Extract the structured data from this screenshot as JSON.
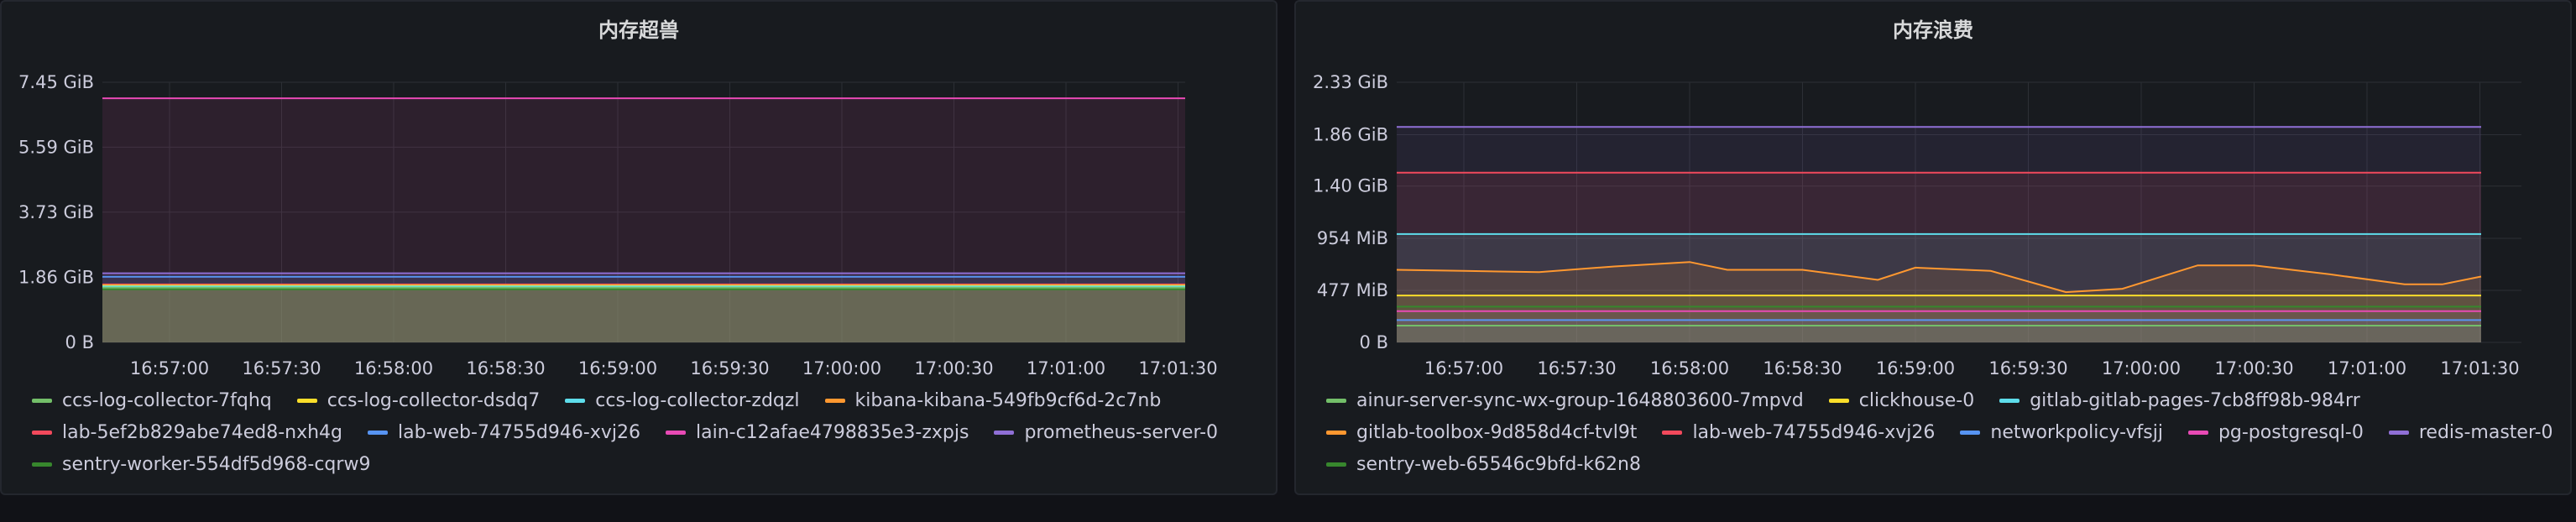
{
  "colors": {
    "background": "#111217",
    "panel": "#181b1f",
    "grid": "#2c2f35",
    "green": "#73bf69",
    "yellow": "#fade2a",
    "cyan": "#5eddeb",
    "orange": "#ff9830",
    "red": "#f2495c",
    "blue": "#5794f2",
    "pink": "#e84ab5",
    "purple": "#8f6fd6",
    "darkgreen": "#37872d"
  },
  "chart_data": [
    {
      "type": "area",
      "title": "内存超兽",
      "unit": "GiB",
      "x": [
        "16:56:30",
        "16:57:00",
        "16:57:30",
        "16:58:00",
        "16:58:30",
        "16:59:00",
        "16:59:30",
        "17:00:00",
        "17:00:30",
        "17:01:00",
        "17:01:20"
      ],
      "x_tick_labels": [
        "16:57:00",
        "16:57:30",
        "16:58:00",
        "16:58:30",
        "16:59:00",
        "16:59:30",
        "17:00:00",
        "17:00:30",
        "17:01:00",
        "17:01:30"
      ],
      "ylim": [
        0,
        7.45
      ],
      "y_ticks": [
        0,
        1.86,
        3.73,
        5.59,
        7.45
      ],
      "y_tick_labels": [
        "0 B",
        "1.86 GiB",
        "3.73 GiB",
        "5.59 GiB",
        "7.45 GiB"
      ],
      "grid": true,
      "legend_position": "bottom",
      "series": [
        {
          "name": "ccs-log-collector-7fqhq",
          "color": "#73bf69",
          "values": [
            1.57,
            1.57,
            1.57,
            1.57,
            1.57,
            1.57,
            1.57,
            1.57,
            1.57,
            1.57,
            1.57
          ]
        },
        {
          "name": "ccs-log-collector-dsdq7",
          "color": "#fade2a",
          "values": [
            1.62,
            1.62,
            1.62,
            1.62,
            1.62,
            1.62,
            1.62,
            1.62,
            1.62,
            1.62,
            1.62
          ]
        },
        {
          "name": "ccs-log-collector-zdqzl",
          "color": "#5eddeb",
          "values": [
            1.6,
            1.6,
            1.6,
            1.6,
            1.6,
            1.6,
            1.6,
            1.6,
            1.6,
            1.6,
            1.6
          ]
        },
        {
          "name": "kibana-kibana-549fb9cf6d-2c7nb",
          "color": "#ff9830",
          "values": [
            1.64,
            1.64,
            1.64,
            1.64,
            1.64,
            1.64,
            1.64,
            1.64,
            1.64,
            1.64,
            1.64
          ]
        },
        {
          "name": "lab-5ef2b829abe74ed8-nxh4g",
          "color": "#f2495c",
          "values": [
            1.66,
            1.66,
            1.66,
            1.66,
            1.66,
            1.66,
            1.66,
            1.66,
            1.66,
            1.66,
            1.66
          ]
        },
        {
          "name": "lab-web-74755d946-xvj26",
          "color": "#5794f2",
          "values": [
            1.88,
            1.88,
            1.88,
            1.88,
            1.88,
            1.88,
            1.88,
            1.88,
            1.88,
            1.88,
            1.88
          ]
        },
        {
          "name": "lain-c12afae4798835e3-zxpjs",
          "color": "#e84ab5",
          "values": [
            6.99,
            6.99,
            6.99,
            6.99,
            6.99,
            6.99,
            6.99,
            6.99,
            6.99,
            6.99,
            6.99
          ]
        },
        {
          "name": "prometheus-server-0",
          "color": "#8f6fd6",
          "values": [
            1.98,
            1.98,
            1.98,
            1.98,
            1.98,
            1.98,
            1.98,
            1.98,
            1.98,
            1.98,
            1.98
          ]
        },
        {
          "name": "sentry-worker-554df5d968-cqrw9",
          "color": "#37872d",
          "values": [
            1.52,
            1.52,
            1.52,
            1.52,
            1.52,
            1.52,
            1.52,
            1.52,
            1.52,
            1.52,
            1.52
          ]
        }
      ]
    },
    {
      "type": "area",
      "title": "内存浪费",
      "unit": "GiB",
      "x": [
        "16:56:40",
        "16:57:00",
        "16:57:20",
        "16:57:40",
        "16:58:00",
        "16:58:10",
        "16:58:30",
        "16:58:50",
        "16:59:00",
        "16:59:20",
        "16:59:40",
        "16:59:55",
        "17:00:15",
        "17:00:30",
        "17:00:50",
        "17:01:10",
        "17:01:20",
        "17:01:40"
      ],
      "x_tick_labels": [
        "16:57:00",
        "16:57:30",
        "16:58:00",
        "16:58:30",
        "16:59:00",
        "16:59:30",
        "17:00:00",
        "17:00:30",
        "17:01:00",
        "17:01:30"
      ],
      "ylim": [
        0,
        2.33
      ],
      "y_ticks": [
        0,
        0.466,
        0.932,
        1.4,
        1.86,
        2.33
      ],
      "y_tick_labels": [
        "0 B",
        "477 MiB",
        "954 MiB",
        "1.40 GiB",
        "1.86 GiB",
        "2.33 GiB"
      ],
      "grid": true,
      "legend_position": "bottom",
      "series": [
        {
          "name": "ainur-server-sync-wx-group-1648803600-7mpvd",
          "color": "#73bf69",
          "values": [
            0.15,
            0.15,
            0.15,
            0.15,
            0.15,
            0.15,
            0.15,
            0.15,
            0.15,
            0.15,
            0.15,
            0.15,
            0.15,
            0.15,
            0.15,
            0.15,
            0.15,
            0.15
          ]
        },
        {
          "name": "clickhouse-0",
          "color": "#fade2a",
          "values": [
            0.42,
            0.42,
            0.42,
            0.42,
            0.42,
            0.42,
            0.42,
            0.42,
            0.42,
            0.42,
            0.42,
            0.42,
            0.42,
            0.42,
            0.42,
            0.42,
            0.42,
            0.42
          ]
        },
        {
          "name": "gitlab-gitlab-pages-7cb8ff98b-984rr",
          "color": "#5eddeb",
          "values": [
            0.97,
            0.97,
            0.97,
            0.97,
            0.97,
            0.97,
            0.97,
            0.97,
            0.97,
            0.97,
            0.97,
            0.97,
            0.97,
            0.97,
            0.97,
            0.97,
            0.97,
            0.97
          ]
        },
        {
          "name": "gitlab-toolbox-9d858d4cf-tvl9t",
          "color": "#ff9830",
          "values": [
            0.65,
            0.64,
            0.63,
            0.68,
            0.72,
            0.65,
            0.65,
            0.56,
            0.67,
            0.64,
            0.45,
            0.48,
            0.69,
            0.69,
            0.61,
            0.52,
            0.52,
            0.59
          ]
        },
        {
          "name": "lab-web-74755d946-xvj26",
          "color": "#f2495c",
          "values": [
            1.52,
            1.52,
            1.52,
            1.52,
            1.52,
            1.52,
            1.52,
            1.52,
            1.52,
            1.52,
            1.52,
            1.52,
            1.52,
            1.52,
            1.52,
            1.52,
            1.52,
            1.52
          ]
        },
        {
          "name": "networkpolicy-vfsjj",
          "color": "#5794f2",
          "values": [
            0.2,
            0.2,
            0.2,
            0.2,
            0.2,
            0.2,
            0.2,
            0.2,
            0.2,
            0.2,
            0.2,
            0.2,
            0.2,
            0.2,
            0.2,
            0.2,
            0.2,
            0.2
          ]
        },
        {
          "name": "pg-postgresql-0",
          "color": "#e84ab5",
          "values": [
            0.28,
            0.28,
            0.28,
            0.28,
            0.28,
            0.28,
            0.28,
            0.28,
            0.28,
            0.28,
            0.28,
            0.28,
            0.28,
            0.28,
            0.28,
            0.28,
            0.28,
            0.28
          ]
        },
        {
          "name": "redis-master-0",
          "color": "#8f6fd6",
          "values": [
            1.93,
            1.93,
            1.93,
            1.93,
            1.93,
            1.93,
            1.93,
            1.93,
            1.93,
            1.93,
            1.93,
            1.93,
            1.93,
            1.93,
            1.93,
            1.93,
            1.93,
            1.93
          ]
        },
        {
          "name": "sentry-web-65546c9bfd-k62n8",
          "color": "#37872d",
          "values": [
            0.32,
            0.32,
            0.32,
            0.32,
            0.32,
            0.32,
            0.32,
            0.32,
            0.32,
            0.32,
            0.32,
            0.32,
            0.32,
            0.32,
            0.32,
            0.32,
            0.32,
            0.32
          ]
        }
      ]
    }
  ]
}
